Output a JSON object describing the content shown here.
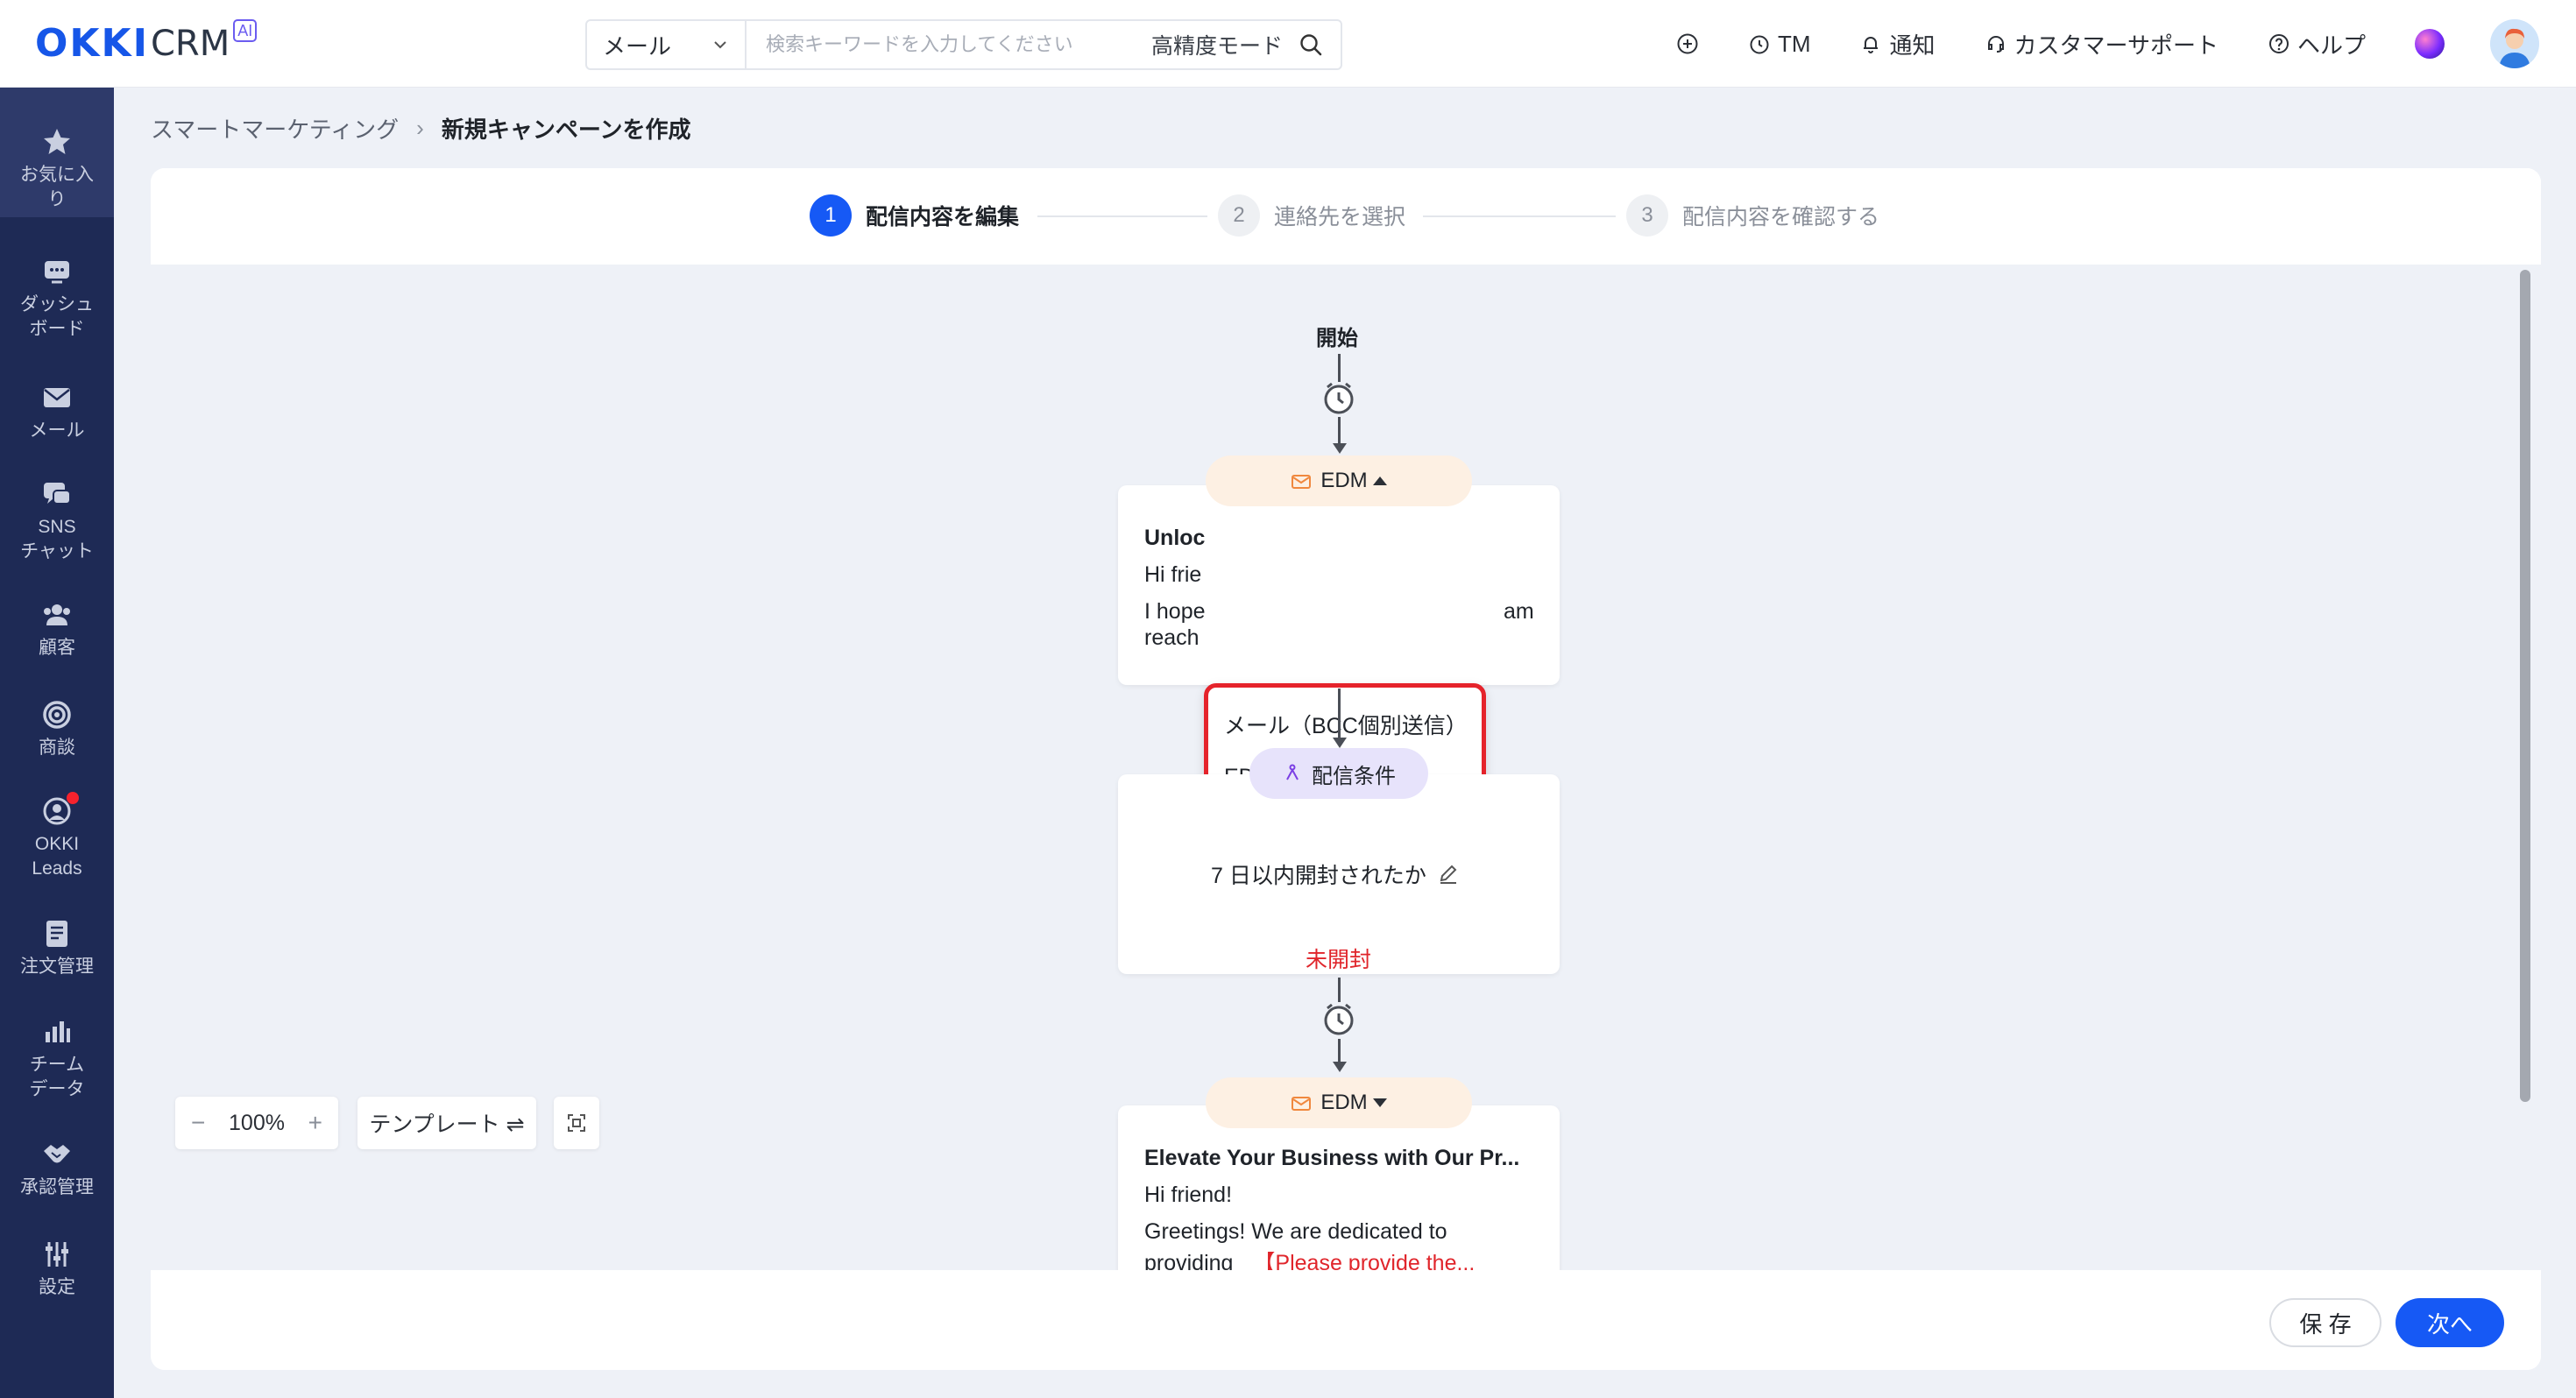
{
  "header": {
    "logo_main": "OKKI",
    "logo_sub": "CRM",
    "logo_badge": "AI",
    "search_type": "メール",
    "search_placeholder": "検索キーワードを入力してください",
    "search_mode": "高精度モード",
    "tm_label": "TM",
    "notify_label": "通知",
    "support_label": "カスタマーサポート",
    "help_label": "ヘルプ"
  },
  "sidebar": {
    "items": [
      {
        "label": "お気に入\nり"
      },
      {
        "label": "ダッシュ\nボード"
      },
      {
        "label": "メール"
      },
      {
        "label": "SNS\nチャット"
      },
      {
        "label": "顧客"
      },
      {
        "label": "商談"
      },
      {
        "label": "OKKI\nLeads"
      },
      {
        "label": "注文管理"
      },
      {
        "label": "チーム\nデータ"
      },
      {
        "label": "承認管理"
      },
      {
        "label": "設定"
      }
    ]
  },
  "breadcrumb": {
    "parent": "スマートマーケティング",
    "separator": "›",
    "current": "新規キャンペーンを作成"
  },
  "steps": [
    {
      "num": "1",
      "label": "配信内容を編集"
    },
    {
      "num": "2",
      "label": "連絡先を選択"
    },
    {
      "num": "3",
      "label": "配信内容を確認する"
    }
  ],
  "flow": {
    "start_label": "開始",
    "node1": {
      "pill": "EDM",
      "title": "Unloc",
      "line1": "Hi frie",
      "line2a": "I hope",
      "line2b": "am",
      "line3": "reach"
    },
    "dropdown": {
      "option1": "メール（BCC個別送信）",
      "option2": "EDM"
    },
    "condition": {
      "pill": "配信条件",
      "text": "7 日以内開封されたか",
      "branch": "未開封"
    },
    "node2": {
      "pill": "EDM",
      "title": "Elevate Your Business with Our Pr...",
      "line1": "Hi friend!",
      "line2": "Greetings! We are dedicated to",
      "line3a": "providing",
      "line3b": "【Please provide the..."
    }
  },
  "toolbar": {
    "zoom_minus": "−",
    "zoom_value": "100%",
    "zoom_plus": "+",
    "template_label": "テンプレート ⇌"
  },
  "footer": {
    "save_label": "保 存",
    "next_label": "次へ"
  },
  "colors": {
    "primary": "#1659f5",
    "sidebar": "#1e2a55",
    "highlight": "#e5232b",
    "edm_pill": "#fdf0e3",
    "condition_pill": "#e7e3fb"
  }
}
